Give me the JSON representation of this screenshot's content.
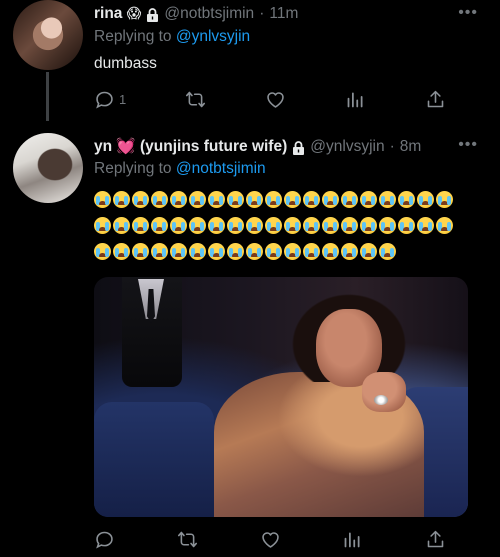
{
  "tweets": [
    {
      "name": "rina",
      "name_emoji": "😱",
      "handle": "@notbtsjimin",
      "time": "11m",
      "replying_prefix": "Replying to",
      "replying_to": "@ynlvsyjin",
      "text": "dumbass",
      "reply_count": "1"
    },
    {
      "name": "yn 💓 (yunjins future wife)",
      "handle": "@ynlvsyjin",
      "time": "8m",
      "replying_prefix": "Replying to",
      "replying_to": "@notbtsjimin",
      "emoji_rows": [
        19,
        19,
        16
      ],
      "emoji_name": "loudly-crying-face",
      "media": "gif-woman-resting-chin-on-hand-in-theater-seat"
    }
  ],
  "separators": {
    "dot": "·",
    "more": "•••"
  },
  "icons": [
    "reply-icon",
    "retweet-icon",
    "like-icon",
    "analytics-icon",
    "share-icon",
    "lock-icon",
    "more-icon"
  ],
  "colors": {
    "background": "#000000",
    "text": "#e7e9ea",
    "muted": "#71767b",
    "link": "#1d9bf0"
  }
}
